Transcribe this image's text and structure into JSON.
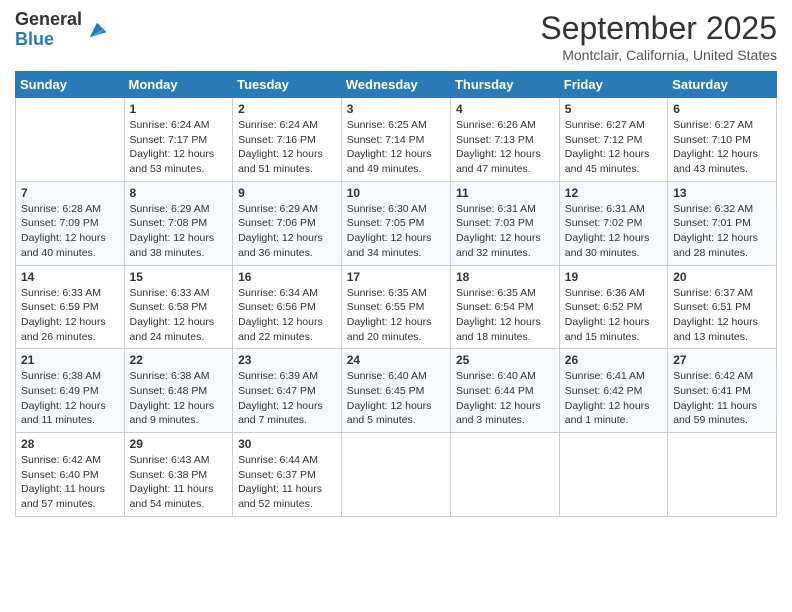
{
  "brand": {
    "name_general": "General",
    "name_blue": "Blue"
  },
  "header": {
    "month": "September 2025",
    "location": "Montclair, California, United States"
  },
  "weekdays": [
    "Sunday",
    "Monday",
    "Tuesday",
    "Wednesday",
    "Thursday",
    "Friday",
    "Saturday"
  ],
  "weeks": [
    [
      {
        "day": "",
        "sunrise": "",
        "sunset": "",
        "daylight": ""
      },
      {
        "day": "1",
        "sunrise": "Sunrise: 6:24 AM",
        "sunset": "Sunset: 7:17 PM",
        "daylight": "Daylight: 12 hours and 53 minutes."
      },
      {
        "day": "2",
        "sunrise": "Sunrise: 6:24 AM",
        "sunset": "Sunset: 7:16 PM",
        "daylight": "Daylight: 12 hours and 51 minutes."
      },
      {
        "day": "3",
        "sunrise": "Sunrise: 6:25 AM",
        "sunset": "Sunset: 7:14 PM",
        "daylight": "Daylight: 12 hours and 49 minutes."
      },
      {
        "day": "4",
        "sunrise": "Sunrise: 6:26 AM",
        "sunset": "Sunset: 7:13 PM",
        "daylight": "Daylight: 12 hours and 47 minutes."
      },
      {
        "day": "5",
        "sunrise": "Sunrise: 6:27 AM",
        "sunset": "Sunset: 7:12 PM",
        "daylight": "Daylight: 12 hours and 45 minutes."
      },
      {
        "day": "6",
        "sunrise": "Sunrise: 6:27 AM",
        "sunset": "Sunset: 7:10 PM",
        "daylight": "Daylight: 12 hours and 43 minutes."
      }
    ],
    [
      {
        "day": "7",
        "sunrise": "Sunrise: 6:28 AM",
        "sunset": "Sunset: 7:09 PM",
        "daylight": "Daylight: 12 hours and 40 minutes."
      },
      {
        "day": "8",
        "sunrise": "Sunrise: 6:29 AM",
        "sunset": "Sunset: 7:08 PM",
        "daylight": "Daylight: 12 hours and 38 minutes."
      },
      {
        "day": "9",
        "sunrise": "Sunrise: 6:29 AM",
        "sunset": "Sunset: 7:06 PM",
        "daylight": "Daylight: 12 hours and 36 minutes."
      },
      {
        "day": "10",
        "sunrise": "Sunrise: 6:30 AM",
        "sunset": "Sunset: 7:05 PM",
        "daylight": "Daylight: 12 hours and 34 minutes."
      },
      {
        "day": "11",
        "sunrise": "Sunrise: 6:31 AM",
        "sunset": "Sunset: 7:03 PM",
        "daylight": "Daylight: 12 hours and 32 minutes."
      },
      {
        "day": "12",
        "sunrise": "Sunrise: 6:31 AM",
        "sunset": "Sunset: 7:02 PM",
        "daylight": "Daylight: 12 hours and 30 minutes."
      },
      {
        "day": "13",
        "sunrise": "Sunrise: 6:32 AM",
        "sunset": "Sunset: 7:01 PM",
        "daylight": "Daylight: 12 hours and 28 minutes."
      }
    ],
    [
      {
        "day": "14",
        "sunrise": "Sunrise: 6:33 AM",
        "sunset": "Sunset: 6:59 PM",
        "daylight": "Daylight: 12 hours and 26 minutes."
      },
      {
        "day": "15",
        "sunrise": "Sunrise: 6:33 AM",
        "sunset": "Sunset: 6:58 PM",
        "daylight": "Daylight: 12 hours and 24 minutes."
      },
      {
        "day": "16",
        "sunrise": "Sunrise: 6:34 AM",
        "sunset": "Sunset: 6:56 PM",
        "daylight": "Daylight: 12 hours and 22 minutes."
      },
      {
        "day": "17",
        "sunrise": "Sunrise: 6:35 AM",
        "sunset": "Sunset: 6:55 PM",
        "daylight": "Daylight: 12 hours and 20 minutes."
      },
      {
        "day": "18",
        "sunrise": "Sunrise: 6:35 AM",
        "sunset": "Sunset: 6:54 PM",
        "daylight": "Daylight: 12 hours and 18 minutes."
      },
      {
        "day": "19",
        "sunrise": "Sunrise: 6:36 AM",
        "sunset": "Sunset: 6:52 PM",
        "daylight": "Daylight: 12 hours and 15 minutes."
      },
      {
        "day": "20",
        "sunrise": "Sunrise: 6:37 AM",
        "sunset": "Sunset: 6:51 PM",
        "daylight": "Daylight: 12 hours and 13 minutes."
      }
    ],
    [
      {
        "day": "21",
        "sunrise": "Sunrise: 6:38 AM",
        "sunset": "Sunset: 6:49 PM",
        "daylight": "Daylight: 12 hours and 11 minutes."
      },
      {
        "day": "22",
        "sunrise": "Sunrise: 6:38 AM",
        "sunset": "Sunset: 6:48 PM",
        "daylight": "Daylight: 12 hours and 9 minutes."
      },
      {
        "day": "23",
        "sunrise": "Sunrise: 6:39 AM",
        "sunset": "Sunset: 6:47 PM",
        "daylight": "Daylight: 12 hours and 7 minutes."
      },
      {
        "day": "24",
        "sunrise": "Sunrise: 6:40 AM",
        "sunset": "Sunset: 6:45 PM",
        "daylight": "Daylight: 12 hours and 5 minutes."
      },
      {
        "day": "25",
        "sunrise": "Sunrise: 6:40 AM",
        "sunset": "Sunset: 6:44 PM",
        "daylight": "Daylight: 12 hours and 3 minutes."
      },
      {
        "day": "26",
        "sunrise": "Sunrise: 6:41 AM",
        "sunset": "Sunset: 6:42 PM",
        "daylight": "Daylight: 12 hours and 1 minute."
      },
      {
        "day": "27",
        "sunrise": "Sunrise: 6:42 AM",
        "sunset": "Sunset: 6:41 PM",
        "daylight": "Daylight: 11 hours and 59 minutes."
      }
    ],
    [
      {
        "day": "28",
        "sunrise": "Sunrise: 6:42 AM",
        "sunset": "Sunset: 6:40 PM",
        "daylight": "Daylight: 11 hours and 57 minutes."
      },
      {
        "day": "29",
        "sunrise": "Sunrise: 6:43 AM",
        "sunset": "Sunset: 6:38 PM",
        "daylight": "Daylight: 11 hours and 54 minutes."
      },
      {
        "day": "30",
        "sunrise": "Sunrise: 6:44 AM",
        "sunset": "Sunset: 6:37 PM",
        "daylight": "Daylight: 11 hours and 52 minutes."
      },
      {
        "day": "",
        "sunrise": "",
        "sunset": "",
        "daylight": ""
      },
      {
        "day": "",
        "sunrise": "",
        "sunset": "",
        "daylight": ""
      },
      {
        "day": "",
        "sunrise": "",
        "sunset": "",
        "daylight": ""
      },
      {
        "day": "",
        "sunrise": "",
        "sunset": "",
        "daylight": ""
      }
    ]
  ]
}
